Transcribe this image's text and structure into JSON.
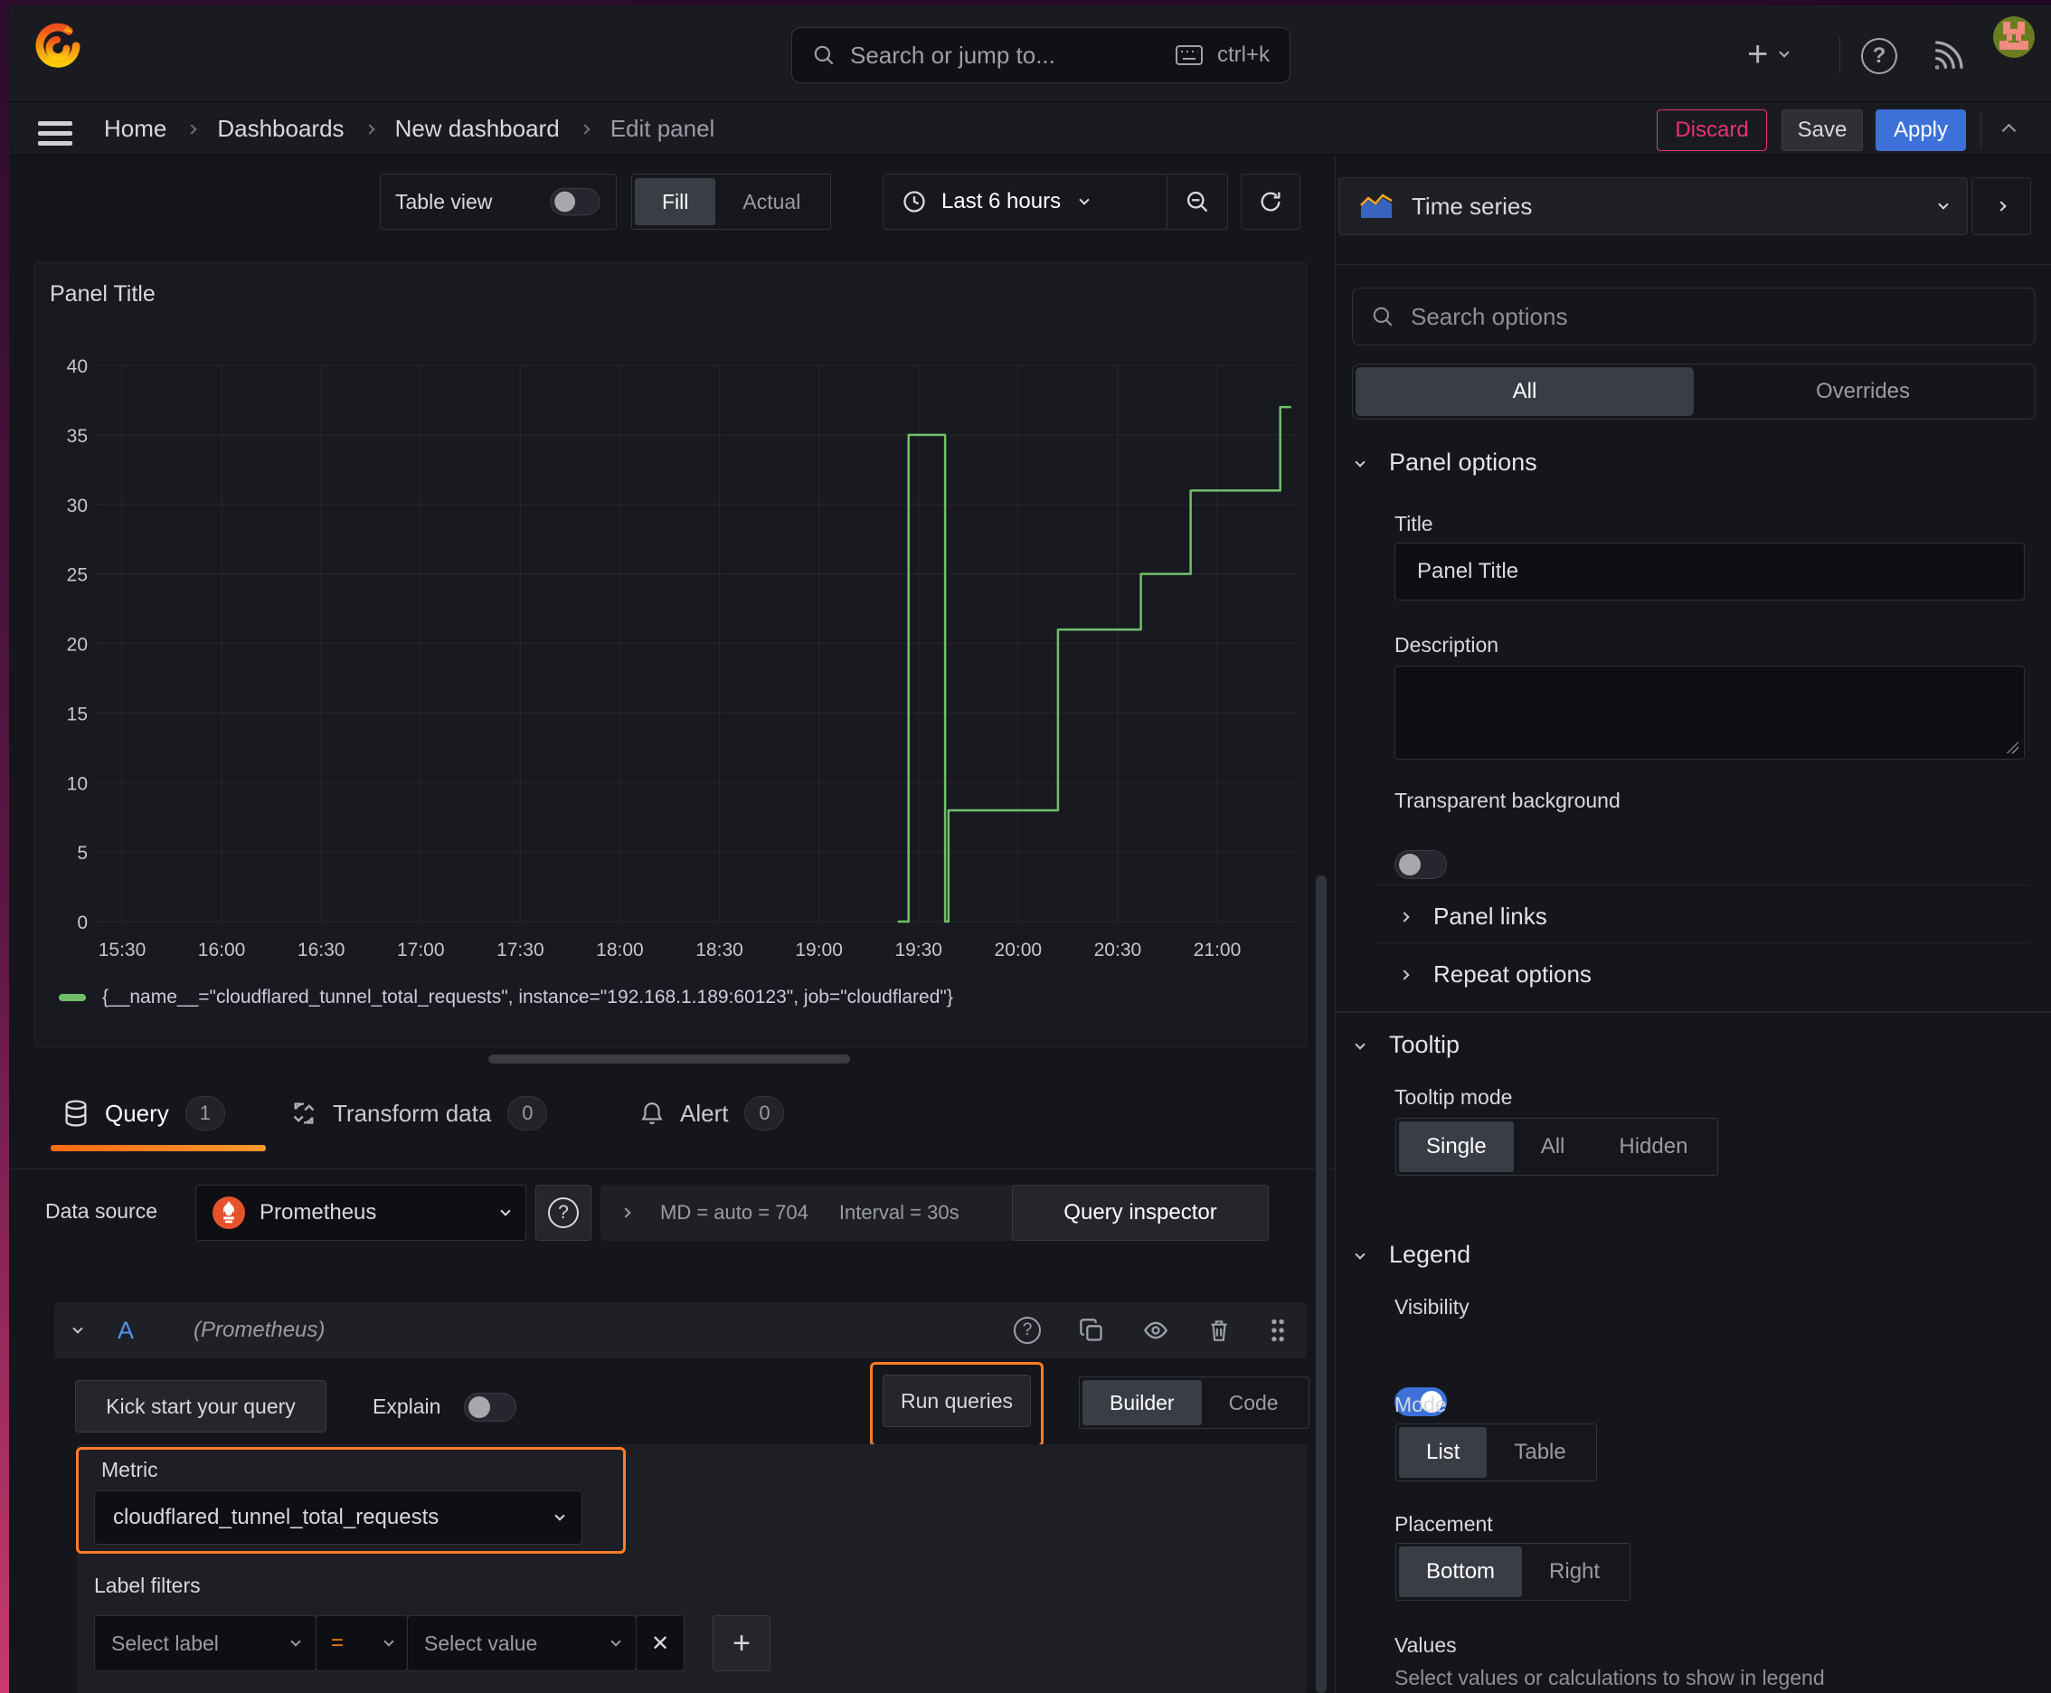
{
  "topbar": {
    "search_placeholder": "Search or jump to...",
    "search_shortcut": "ctrl+k"
  },
  "breadcrumb": {
    "home": "Home",
    "dashboards": "Dashboards",
    "new_dashboard": "New dashboard",
    "edit_panel": "Edit panel",
    "discard": "Discard",
    "save": "Save",
    "apply": "Apply"
  },
  "viewbar": {
    "table_view": "Table view",
    "fill": "Fill",
    "actual": "Actual",
    "time_range": "Last 6 hours"
  },
  "panel": {
    "title": "Panel Title",
    "legend_label": "{__name__=\"cloudflared_tunnel_total_requests\", instance=\"192.168.1.189:60123\", job=\"cloudflared\"}"
  },
  "chart_data": {
    "type": "line",
    "title": "Panel Title",
    "x_ticks": [
      "15:30",
      "16:00",
      "16:30",
      "17:00",
      "17:30",
      "18:00",
      "18:30",
      "19:00",
      "19:30",
      "20:00",
      "20:30",
      "21:00"
    ],
    "x_tick_minutes": [
      0,
      30,
      60,
      90,
      120,
      150,
      180,
      210,
      240,
      270,
      300,
      330
    ],
    "y_ticks": [
      0,
      5,
      10,
      15,
      20,
      25,
      30,
      35,
      40
    ],
    "ylim": [
      0,
      40
    ],
    "grid": true,
    "legend_position": "bottom",
    "x_unit": "minutes after 15:30",
    "series": [
      {
        "name": "{__name__=\"cloudflared_tunnel_total_requests\", instance=\"192.168.1.189:60123\", job=\"cloudflared\"}",
        "color": "#73bf69",
        "points": [
          [
            234,
            0
          ],
          [
            237,
            0
          ],
          [
            237,
            35
          ],
          [
            248,
            35
          ],
          [
            248,
            0
          ],
          [
            249,
            0
          ],
          [
            249,
            8
          ],
          [
            282,
            8
          ],
          [
            282,
            21
          ],
          [
            307,
            21
          ],
          [
            307,
            25
          ],
          [
            322,
            25
          ],
          [
            322,
            31
          ],
          [
            349,
            31
          ],
          [
            349,
            37
          ],
          [
            352,
            37
          ]
        ]
      }
    ]
  },
  "querytabs": {
    "query": "Query",
    "query_count": "1",
    "transform": "Transform data",
    "transform_count": "0",
    "alert": "Alert",
    "alert_count": "0"
  },
  "datasource": {
    "label": "Data source",
    "name": "Prometheus",
    "md_stat": "MD = auto = 704",
    "interval_stat": "Interval = 30s",
    "query_inspector": "Query inspector"
  },
  "query_editor": {
    "ref_id": "A",
    "ds_hint": "(Prometheus)",
    "kick_start": "Kick start your query",
    "explain": "Explain",
    "run_queries": "Run queries",
    "builder": "Builder",
    "code": "Code",
    "metric_label": "Metric",
    "metric_value": "cloudflared_tunnel_total_requests",
    "label_filters_label": "Label filters",
    "select_label_placeholder": "Select label",
    "operator": "=",
    "select_value_placeholder": "Select value",
    "remove_filter": "✕",
    "add_filter": "+"
  },
  "options_pane": {
    "viz_type": "Time series",
    "search_placeholder": "Search options",
    "tab_all": "All",
    "tab_overrides": "Overrides",
    "panel_options": {
      "heading": "Panel options",
      "title_label": "Title",
      "title_value": "Panel Title",
      "description_label": "Description",
      "transparent_label": "Transparent background"
    },
    "panel_links": "Panel links",
    "repeat_options": "Repeat options",
    "tooltip": {
      "heading": "Tooltip",
      "mode_label": "Tooltip mode",
      "modes": [
        "Single",
        "All",
        "Hidden"
      ],
      "selected_mode": "Single"
    },
    "legend": {
      "heading": "Legend",
      "visibility_label": "Visibility",
      "mode_label": "Mode",
      "modes": [
        "List",
        "Table"
      ],
      "selected_mode": "List",
      "placement_label": "Placement",
      "placements": [
        "Bottom",
        "Right"
      ],
      "selected_placement": "Bottom",
      "values_label": "Values",
      "values_description": "Select values or calculations to show in legend"
    }
  },
  "colors": {
    "accent_orange": "#ff7c28",
    "series_green": "#73bf69",
    "primary_blue": "#3d71d9",
    "destructive_red": "#e8336e",
    "prometheus_orange": "#e6522c"
  }
}
